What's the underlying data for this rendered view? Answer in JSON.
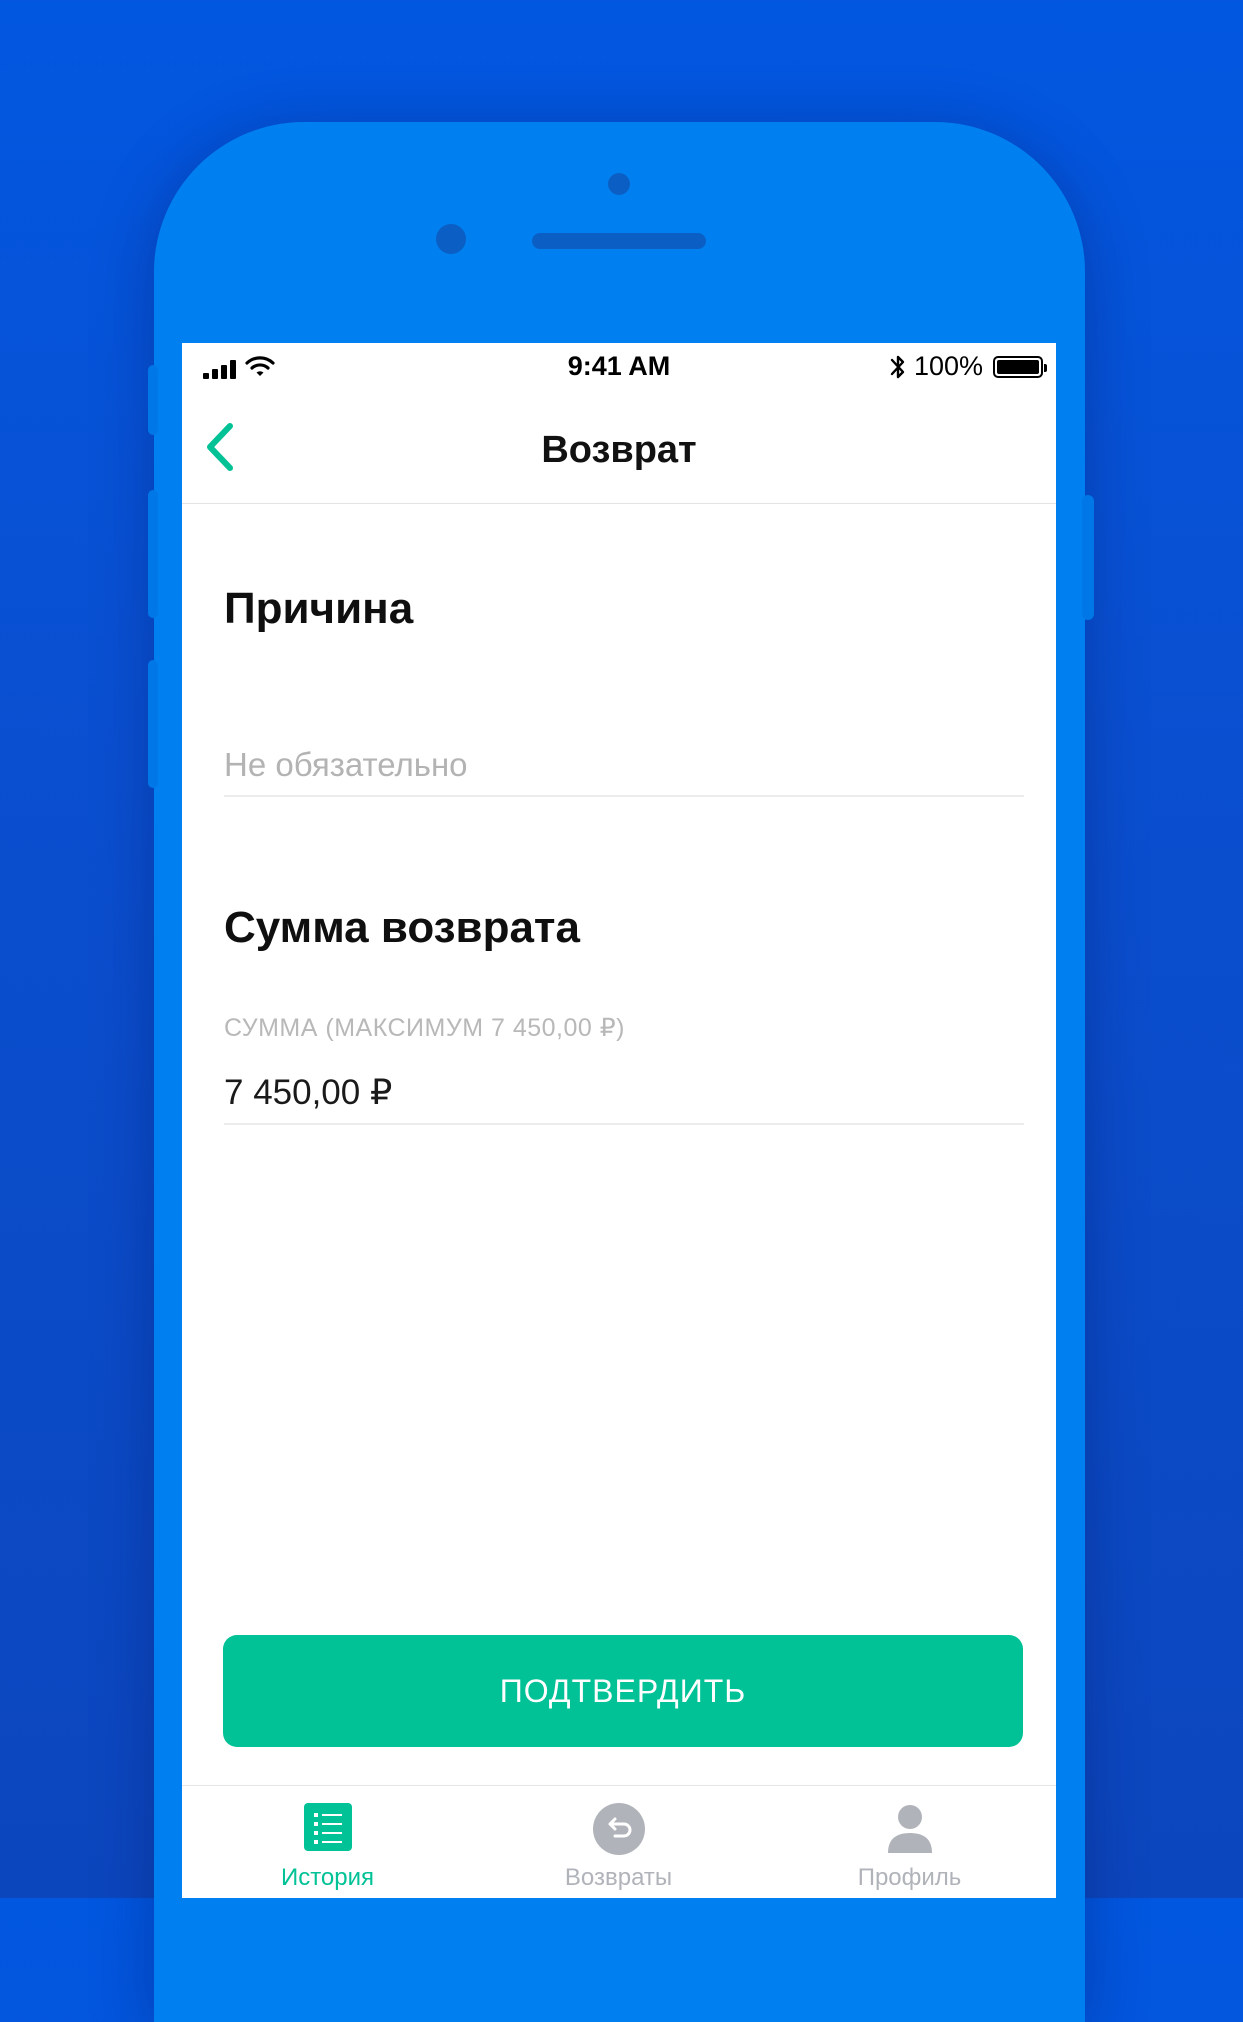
{
  "status_bar": {
    "time": "9:41 AM",
    "battery_percent": "100%",
    "icons": [
      "signal-icon",
      "wifi-icon",
      "bluetooth-icon",
      "battery-icon"
    ]
  },
  "navbar": {
    "title": "Возврат",
    "back_icon": "chevron-left-icon"
  },
  "reason": {
    "title": "Причина",
    "placeholder": "Не обязательно",
    "value": ""
  },
  "refund": {
    "title": "Сумма возврата",
    "amount_label": "СУММА (МАКСИМУМ 7 450,00 ₽)",
    "amount_value": "7 450,00 ₽"
  },
  "confirm_label": "ПОДТВЕРДИТЬ",
  "tabs": [
    {
      "label": "История",
      "icon": "list-icon",
      "active": true
    },
    {
      "label": "Возвраты",
      "icon": "undo-icon",
      "active": false
    },
    {
      "label": "Профиль",
      "icon": "user-icon",
      "active": false
    }
  ],
  "colors": {
    "accent": "#00C296",
    "inactive": "#B0B3B9",
    "background": "#0257E0",
    "device": "#0080F0"
  }
}
